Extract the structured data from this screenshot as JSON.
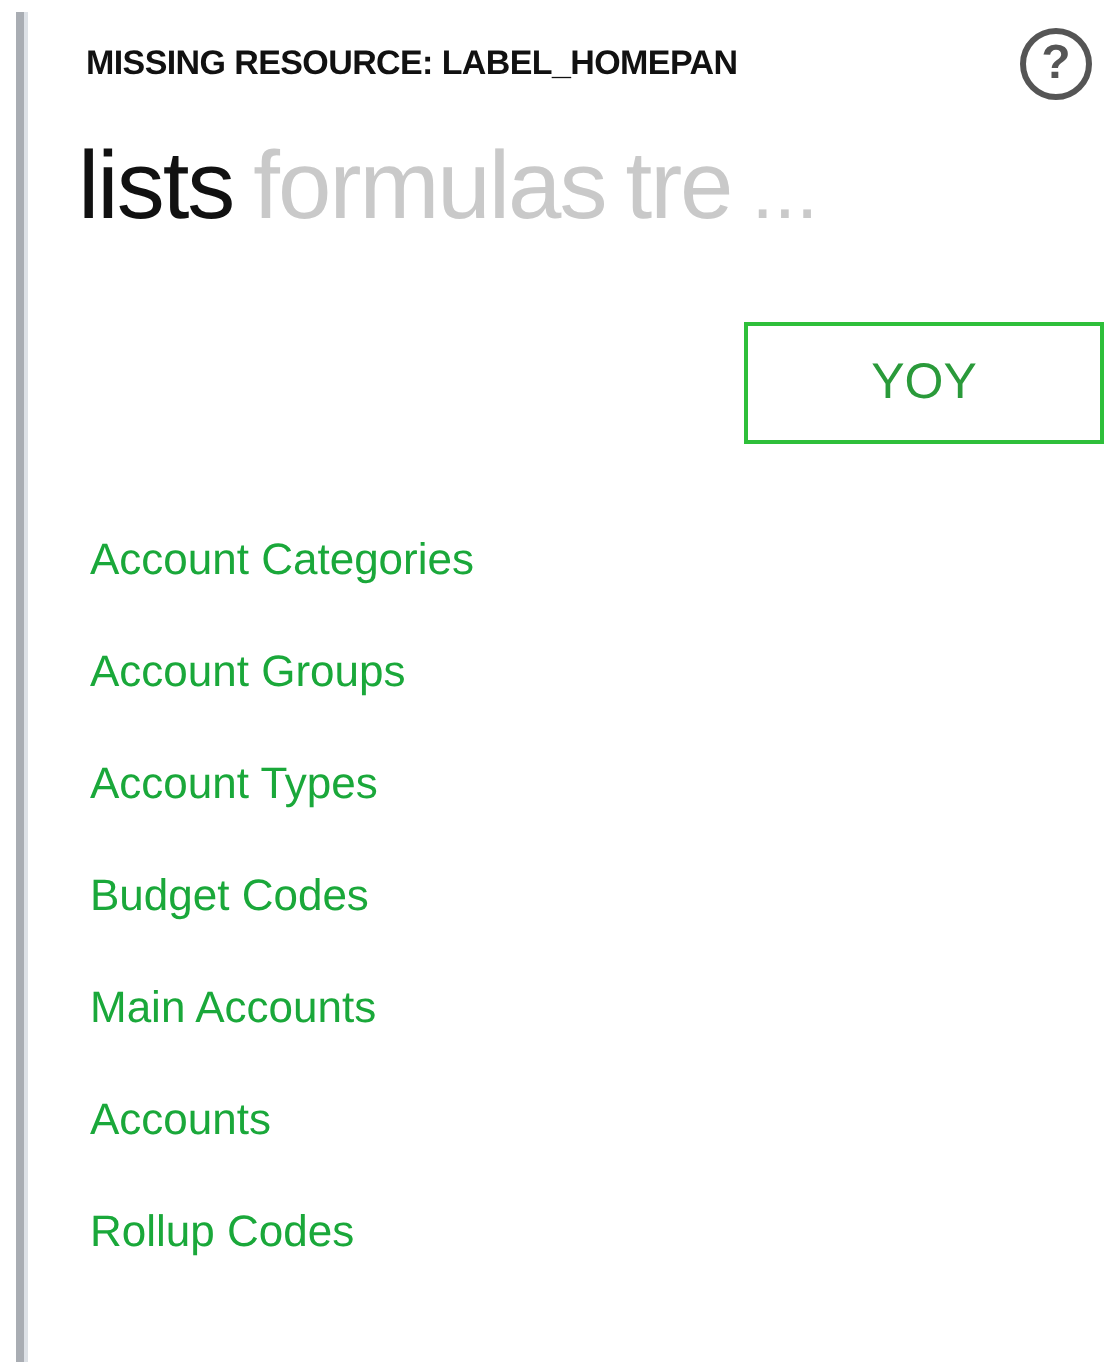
{
  "header": {
    "title": "MISSING RESOURCE: LABEL_HOMEPAN",
    "help": "?"
  },
  "tabs": [
    {
      "label": "lists",
      "selected": true
    },
    {
      "label": "formulas",
      "selected": false
    },
    {
      "label": "tre",
      "selected": false
    }
  ],
  "more": "...",
  "button": "YOY",
  "links": [
    "Account Categories",
    "Account Groups",
    "Account Types",
    "Budget Codes",
    "Main Accounts",
    "Accounts",
    "Rollup Codes"
  ]
}
